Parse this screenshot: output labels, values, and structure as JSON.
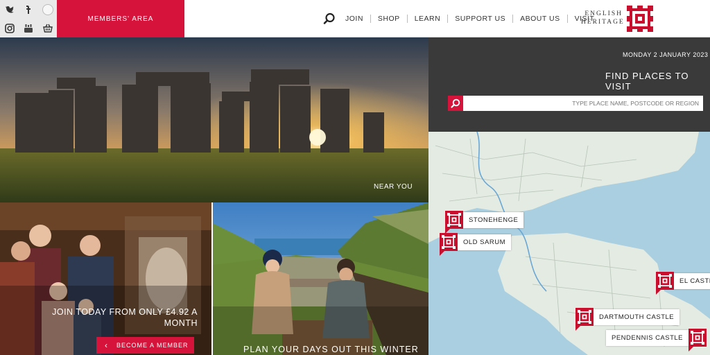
{
  "header": {
    "members_label": "MEMBERS' AREA",
    "nav": [
      "JOIN",
      "SHOP",
      "LEARN",
      "SUPPORT US",
      "ABOUT US",
      "VISIT"
    ],
    "logo_line1": "ENGLISH",
    "logo_line2": "HERITAGE",
    "social_icons": [
      "twitter-icon",
      "facebook-icon",
      "blank-circle",
      "instagram-icon",
      "youtube-icon",
      "basket-icon"
    ]
  },
  "hero": {
    "label": "NEAR YOU"
  },
  "panel": {
    "date": "MONDAY 2 JANUARY 2023",
    "title": "FIND PLACES TO VISIT",
    "search_placeholder": "TYPE PLACE NAME, POSTCODE OR REGION"
  },
  "map": {
    "pins": [
      "STONEHENGE",
      "OLD SARUM",
      "EL CASTLE",
      "DARTMOUTH CASTLE",
      "PENDENNIS CASTLE"
    ]
  },
  "tiles": {
    "join_text": "JOIN TODAY FROM ONLY £4.92 A MONTH",
    "become_label": "BECOME A MEMBER",
    "plan_text": "PLAN YOUR DAYS OUT THIS WINTER"
  },
  "colors": {
    "brand_red": "#d6133a",
    "panel_dark": "#3a3a3a"
  }
}
